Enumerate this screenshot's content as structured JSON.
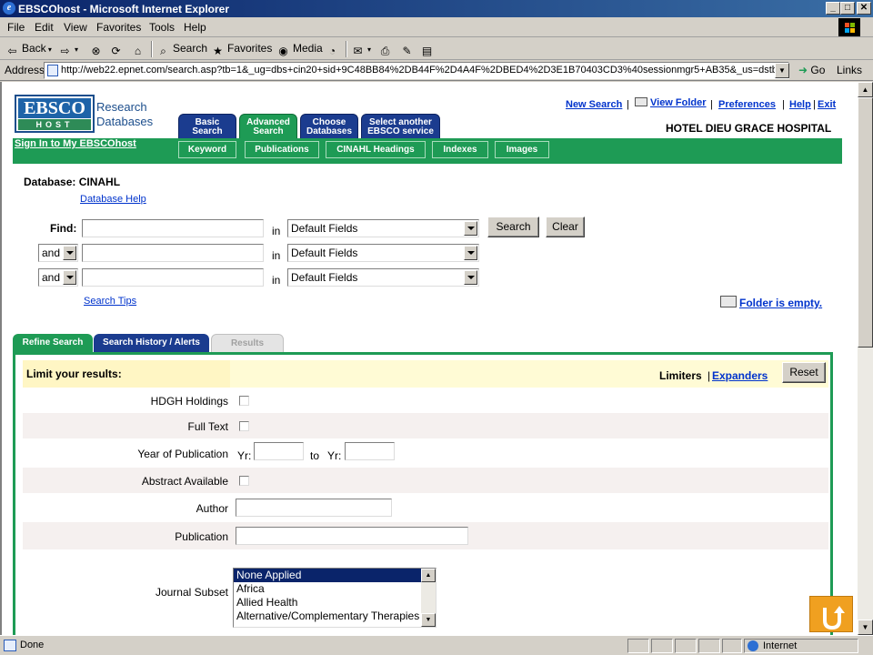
{
  "window": {
    "title": "EBSCOhost - Microsoft Internet Explorer",
    "controls": [
      "_",
      "□",
      "✕"
    ]
  },
  "menu": [
    "File",
    "Edit",
    "View",
    "Favorites",
    "Tools",
    "Help"
  ],
  "toolbar": {
    "back": "Back",
    "search": "Search",
    "favorites": "Favorites",
    "media": "Media"
  },
  "address": {
    "label": "Address",
    "url": "http://web22.epnet.com/search.asp?tb=1&_ug=dbs+cin20+sid+9C48BB84%2DB44F%2D4A4F%2DBED4%2D3E1B70403CD3%40sessionmgr5+AB35&_us=dstb+DB+hs+0+",
    "go": "Go",
    "links": "Links"
  },
  "status": {
    "text": "Done",
    "zone": "Internet"
  },
  "logo": {
    "top": "EBSCO",
    "bottom": "HOST",
    "line1": "Research",
    "line2": "Databases"
  },
  "nav_tabs": [
    {
      "line1": "Basic",
      "line2": "Search"
    },
    {
      "line1": "Advanced",
      "line2": "Search"
    },
    {
      "line1": "Choose",
      "line2": "Databases"
    },
    {
      "line1": "Select another",
      "line2": "EBSCO service"
    }
  ],
  "top_links": {
    "new_search": "New Search",
    "view_folder": "View Folder",
    "preferences": "Preferences",
    "help": "Help",
    "exit": "Exit",
    "sep": "|"
  },
  "institution": "HOTEL DIEU GRACE HOSPITAL",
  "signin": "Sign In to My EBSCOhost",
  "sub_tabs": [
    "Keyword",
    "Publications",
    "CINAHL Headings",
    "Indexes",
    "Images"
  ],
  "database": {
    "label": "Database: CINAHL",
    "help": "Database Help"
  },
  "find": {
    "label": "Find:",
    "in": "in",
    "field": "Default Fields",
    "operator": "and",
    "search_btn": "Search",
    "clear_btn": "Clear",
    "tips": "Search Tips",
    "folder_status": "Folder is empty."
  },
  "panel_tabs": [
    "Refine Search",
    "Search History / Alerts",
    "Results"
  ],
  "limits": {
    "title": "Limit your results:",
    "limiters": "Limiters",
    "sep": "|",
    "expanders": "Expanders",
    "reset": "Reset",
    "hdgh": "HDGH Holdings",
    "full_text": "Full Text",
    "year": "Year of Publication",
    "yr": "Yr:",
    "to": "to",
    "abstract": "Abstract Available",
    "author": "Author",
    "publication": "Publication",
    "journal_subset": "Journal Subset",
    "subset_options": [
      "None Applied",
      "Africa",
      "Allied Health",
      "Alternative/Complementary Therapies"
    ]
  },
  "colors": {
    "ebsco_green": "#1e9b55",
    "ebsco_blue": "#1b3c8f",
    "link_blue": "#0033cc",
    "back_to_top": "#f0a020"
  }
}
